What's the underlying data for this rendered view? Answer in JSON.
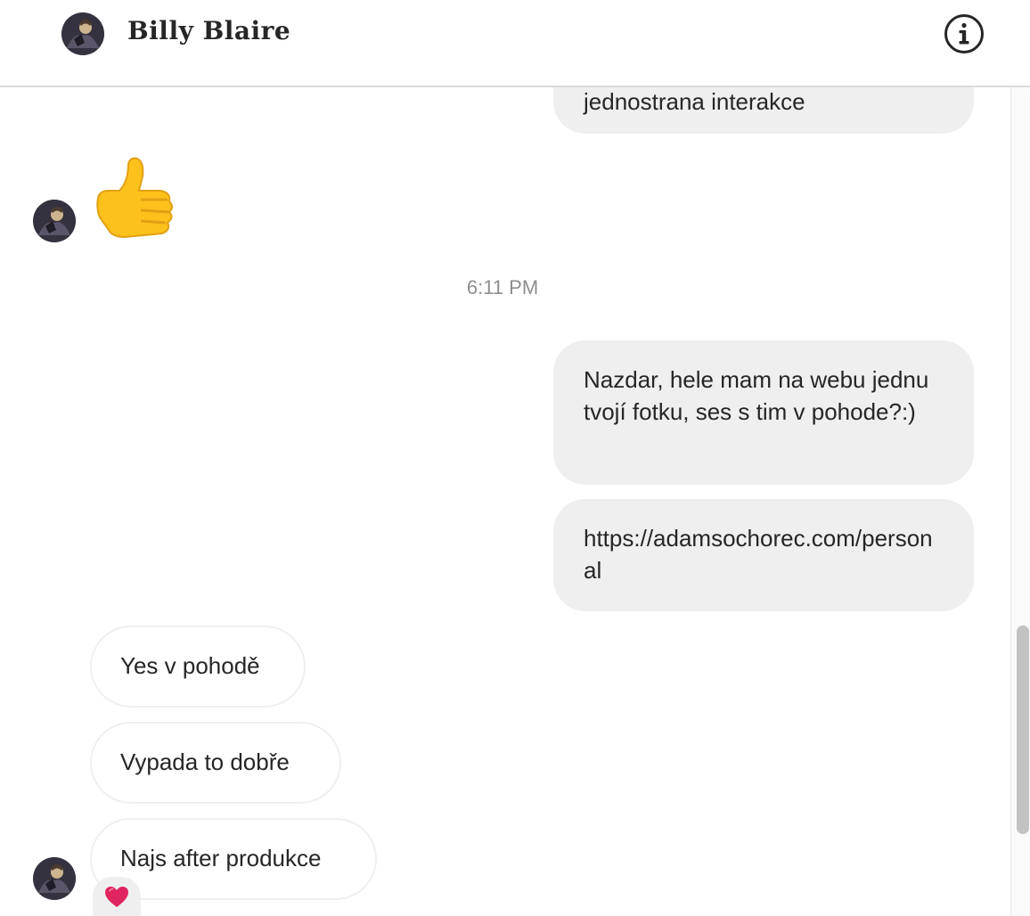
{
  "header": {
    "contact_name": "Billy Blaire",
    "avatar_icon": "profile-photo",
    "info_icon": "info-icon"
  },
  "messages": {
    "partial_out_text": "jednostrana interakce",
    "thumbs_emoji": "thumbs-up-icon",
    "timestamp": "6:11 PM",
    "out_1": "Nazdar, hele mam na webu jednu tvojí fotku, ses s tim v pohode?:)",
    "out_2": "https://adamsochorec.com/personal",
    "in_1": "Yes v pohodě",
    "in_2": "Vypada to dobře",
    "in_3": "Najs after produkce",
    "in_3_reaction": "heart-icon"
  },
  "colors": {
    "outgoing_bubble": "#efefef",
    "text": "#262626",
    "timestamp": "#8e8e8e",
    "heart": "#e0245e"
  }
}
